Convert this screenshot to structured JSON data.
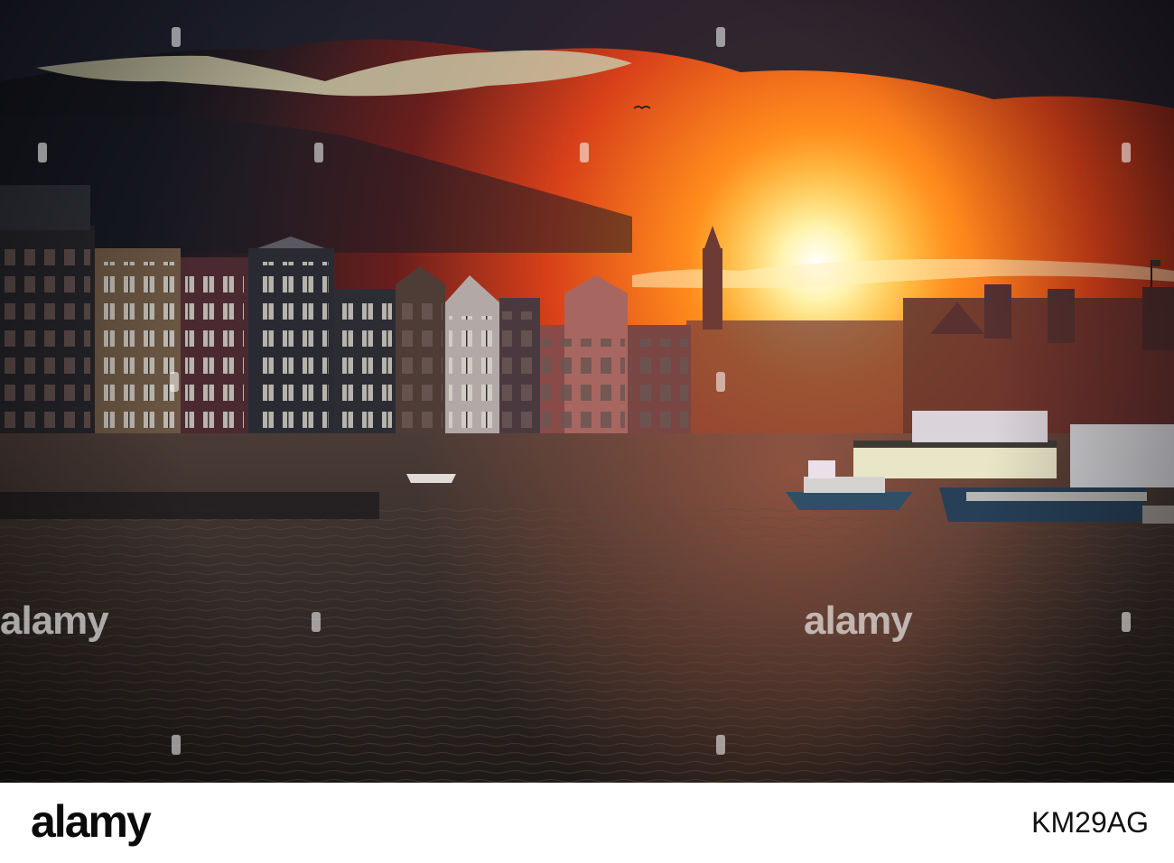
{
  "watermark": {
    "text": "alamy"
  },
  "footer": {
    "logo": "alamy",
    "image_id": "KM29AG"
  },
  "colors": {
    "sun": "#fff6c8",
    "sky_glow": "#ff6a14",
    "sky_dark": "#1a1c2a",
    "water": "#2c2622"
  }
}
